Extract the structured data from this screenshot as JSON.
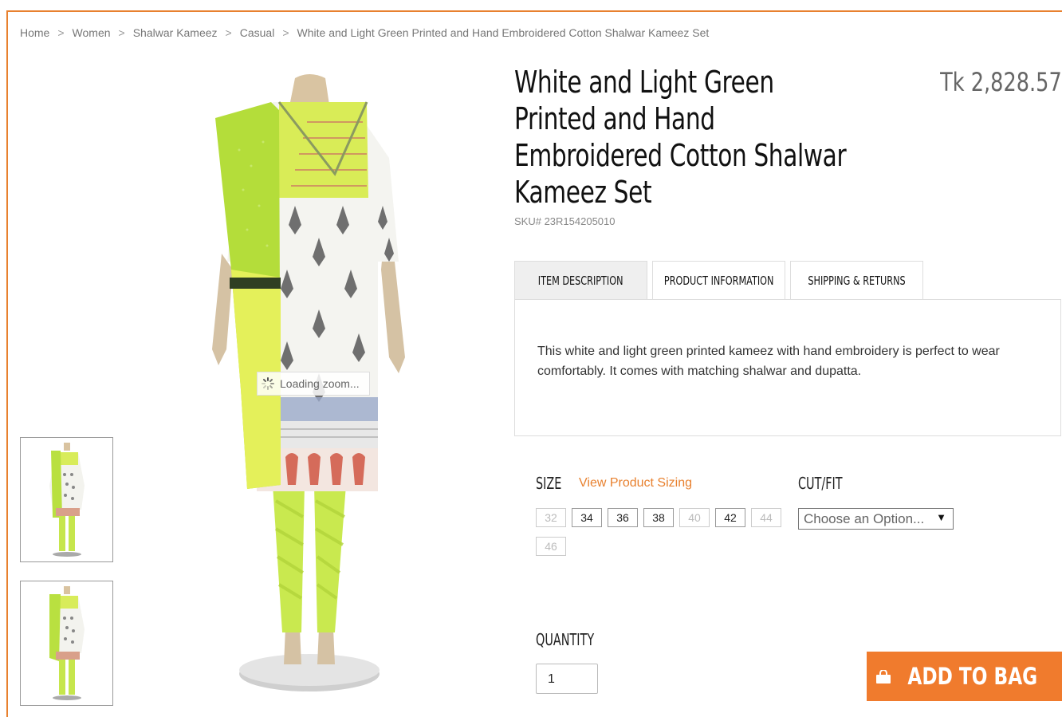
{
  "breadcrumb": {
    "items": [
      "Home",
      "Women",
      "Shalwar Kameez",
      "Casual",
      "White and Light Green Printed and Hand Embroidered Cotton Shalwar Kameez Set"
    ],
    "separator": ">"
  },
  "product": {
    "title_lines": [
      "White and Light Green",
      "Printed and Hand",
      "Embroidered Cotton Shalwar",
      "Kameez Set"
    ],
    "price": "Tk 2,828.57",
    "sku": "SKU# 23R154205010"
  },
  "tabs": [
    {
      "label": "ITEM DESCRIPTION",
      "active": true
    },
    {
      "label": "PRODUCT INFORMATION",
      "active": false
    },
    {
      "label": "SHIPPING & RETURNS",
      "active": false
    }
  ],
  "description": "This white and light green printed kameez with hand embroidery is perfect to wear comfortably. It comes with matching shalwar and dupatta.",
  "size": {
    "label": "SIZE",
    "sizing_link": "View Product Sizing",
    "options": [
      {
        "value": "32",
        "available": false
      },
      {
        "value": "34",
        "available": true
      },
      {
        "value": "36",
        "available": true
      },
      {
        "value": "38",
        "available": true
      },
      {
        "value": "40",
        "available": false
      },
      {
        "value": "42",
        "available": true
      },
      {
        "value": "44",
        "available": false
      },
      {
        "value": "46",
        "available": false
      }
    ]
  },
  "cutfit": {
    "label": "CUT/FIT",
    "selected": "Choose an Option..."
  },
  "quantity": {
    "label": "QUANTITY",
    "value": "1"
  },
  "cart": {
    "add_label": "ADD TO BAG"
  },
  "gallery": {
    "loading_text": "Loading zoom..."
  },
  "colors": {
    "accent": "#f07b2d",
    "border": "#e8812f",
    "lime": "#c8e645"
  },
  "icons": [
    "shopping-bag-icon",
    "spinner-icon"
  ]
}
